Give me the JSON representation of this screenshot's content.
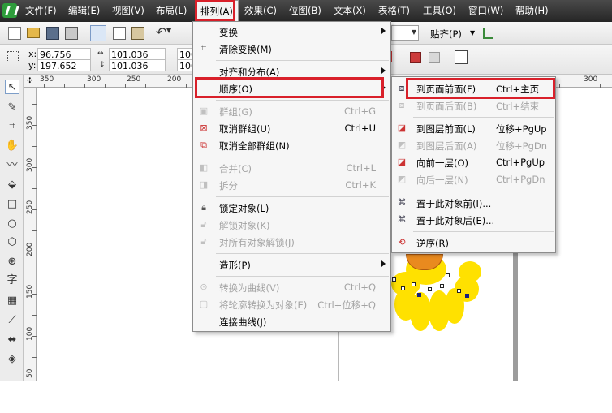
{
  "menubar": {
    "items": [
      {
        "label": "文件(F)"
      },
      {
        "label": "编辑(E)"
      },
      {
        "label": "视图(V)"
      },
      {
        "label": "布局(L)"
      },
      {
        "label": "排列(A)"
      },
      {
        "label": "效果(C)"
      },
      {
        "label": "位图(B)"
      },
      {
        "label": "文本(X)"
      },
      {
        "label": "表格(T)"
      },
      {
        "label": "工具(O)"
      },
      {
        "label": "窗口(W)"
      },
      {
        "label": "帮助(H)"
      }
    ],
    "open_index": 4
  },
  "toolbar": {
    "snap_label": "贴齐(P)"
  },
  "property_bar": {
    "x_label": "x:",
    "x_value": "96.756 mm",
    "y_label": "y:",
    "y_value": "197.652 mm",
    "w_value": "101.036 mm",
    "h_value": "101.036 mm",
    "scale_w": "100",
    "scale_h": "100"
  },
  "ruler": {
    "h_labels": [
      "350",
      "300",
      "250",
      "200",
      "300"
    ],
    "v_labels": [
      "350",
      "300",
      "250",
      "200",
      "150",
      "100",
      "50"
    ]
  },
  "arrange_menu": {
    "items": [
      {
        "label": "变换",
        "shortcut": "",
        "submenu": true,
        "disabled": false,
        "icon": ""
      },
      {
        "label": "清除变换(M)",
        "shortcut": "",
        "submenu": false,
        "disabled": false,
        "icon": "clear-transform-icon"
      },
      {
        "label": "对齐和分布(A)",
        "shortcut": "",
        "submenu": true,
        "disabled": false,
        "icon": ""
      },
      {
        "label": "顺序(O)",
        "shortcut": "",
        "submenu": true,
        "disabled": false,
        "icon": ""
      },
      {
        "label": "群组(G)",
        "shortcut": "Ctrl+G",
        "submenu": false,
        "disabled": true,
        "icon": "group-icon"
      },
      {
        "label": "取消群组(U)",
        "shortcut": "Ctrl+U",
        "submenu": false,
        "disabled": false,
        "icon": "ungroup-icon"
      },
      {
        "label": "取消全部群组(N)",
        "shortcut": "",
        "submenu": false,
        "disabled": false,
        "icon": "ungroup-all-icon"
      },
      {
        "label": "合并(C)",
        "shortcut": "Ctrl+L",
        "submenu": false,
        "disabled": true,
        "icon": "combine-icon"
      },
      {
        "label": "拆分",
        "shortcut": "Ctrl+K",
        "submenu": false,
        "disabled": true,
        "icon": "break-apart-icon"
      },
      {
        "label": "锁定对象(L)",
        "shortcut": "",
        "submenu": false,
        "disabled": false,
        "icon": "lock-icon"
      },
      {
        "label": "解锁对象(K)",
        "shortcut": "",
        "submenu": false,
        "disabled": true,
        "icon": "unlock-icon"
      },
      {
        "label": "对所有对象解锁(J)",
        "shortcut": "",
        "submenu": false,
        "disabled": true,
        "icon": "unlock-all-icon"
      },
      {
        "label": "造形(P)",
        "shortcut": "",
        "submenu": true,
        "disabled": false,
        "icon": ""
      },
      {
        "label": "转换为曲线(V)",
        "shortcut": "Ctrl+Q",
        "submenu": false,
        "disabled": true,
        "icon": "convert-curves-icon"
      },
      {
        "label": "将轮廓转换为对象(E)",
        "shortcut": "Ctrl+位移+Q",
        "submenu": false,
        "disabled": true,
        "icon": "outline-to-object-icon"
      },
      {
        "label": "连接曲线(J)",
        "shortcut": "",
        "submenu": false,
        "disabled": false,
        "icon": ""
      }
    ]
  },
  "order_submenu": {
    "items": [
      {
        "label": "到页面前面(F)",
        "shortcut": "Ctrl+主页",
        "disabled": false
      },
      {
        "label": "到页面后面(B)",
        "shortcut": "Ctrl+结束",
        "disabled": true
      },
      {
        "label": "到图层前面(L)",
        "shortcut": "位移+PgUp",
        "disabled": false
      },
      {
        "label": "到图层后面(A)",
        "shortcut": "位移+PgDn",
        "disabled": true
      },
      {
        "label": "向前一层(O)",
        "shortcut": "Ctrl+PgUp",
        "disabled": false
      },
      {
        "label": "向后一层(N)",
        "shortcut": "Ctrl+PgDn",
        "disabled": true
      },
      {
        "label": "置于此对象前(I)...",
        "shortcut": "",
        "disabled": false
      },
      {
        "label": "置于此对象后(E)...",
        "shortcut": "",
        "disabled": false
      },
      {
        "label": "逆序(R)",
        "shortcut": "",
        "disabled": false
      }
    ]
  },
  "colors": {
    "highlight": "#d9202a",
    "menubar": "#2e2e2e",
    "petal": "#ffe100",
    "seed": "#e98a1f"
  }
}
